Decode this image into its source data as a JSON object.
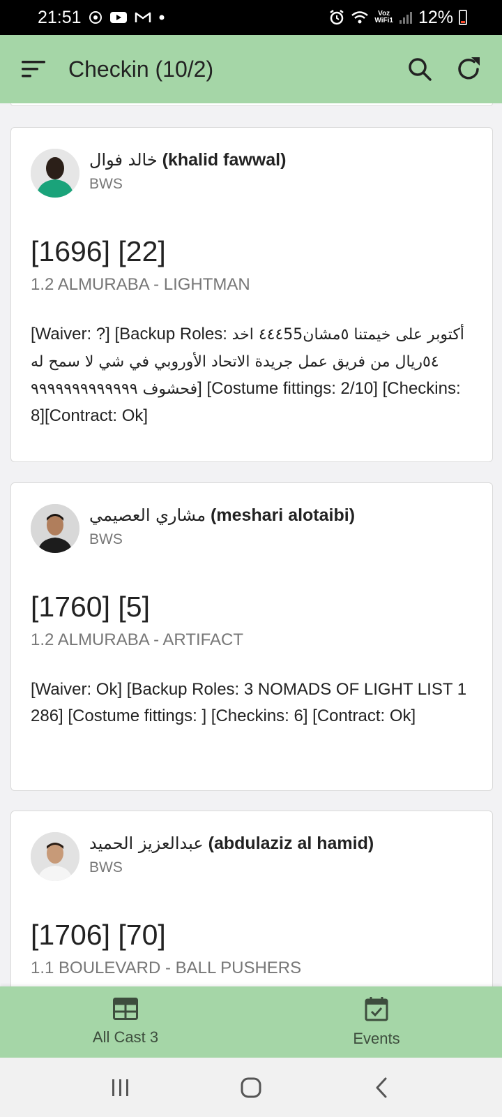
{
  "status_bar": {
    "time": "21:51",
    "voz_top": "Voz",
    "voz_bottom": "WiFi1",
    "battery": "12%",
    "icons": [
      "whatsapp-icon",
      "youtube-icon",
      "gmail-icon",
      "dot-icon",
      "alarm-icon",
      "wifi-icon",
      "signal-icon",
      "battery-icon"
    ]
  },
  "app_bar": {
    "title": "Checkin (10/2)",
    "icons": [
      "menu-sort-icon",
      "search-icon",
      "refresh-icon"
    ]
  },
  "cards": [
    {
      "name_ar": "خالد فوال",
      "name_en": "(khalid fawwal)",
      "group": "BWS",
      "ids": "[1696] [22]",
      "role": "1.2 ALMURABA - LIGHTMAN",
      "details_pre": "[Waiver: ?] [Backup Roles: ",
      "details_ar": "أكتوبر على خيمتنا ٥مشان٤٤٤55 اخد ٥٤ريال من فريق عمل جريدة الاتحاد الأوروبي في شي لا سمح له فحشوف ٩٩٩٩٩٩٩٩٩٩٩٩٩",
      "details_post": "] [Costume fittings: 2/10] [Checkins: 8][Contract: Ok]"
    },
    {
      "name_ar": "مشاري العصيمي",
      "name_en": "(meshari alotaibi)",
      "group": "BWS",
      "ids": "[1760] [5]",
      "role": "1.2 ALMURABA - ARTIFACT",
      "details": "[Waiver: Ok] [Backup Roles: 3 NOMADS OF LIGHT LIST 1 286] [Costume fittings: ] [Checkins: 6] [Contract: Ok]"
    },
    {
      "name_ar": "عبدالعزيز الحميد",
      "name_en": "(abdulaziz al hamid)",
      "group": "BWS",
      "ids": "[1706] [70]",
      "role": "1.1 BOULEVARD - BALL PUSHERS"
    }
  ],
  "bottom_nav": {
    "items": [
      {
        "label": "All Cast 3",
        "icon": "grid-table-icon"
      },
      {
        "label": "Events",
        "icon": "calendar-check-icon"
      }
    ]
  },
  "system_nav": [
    "recent-apps-icon",
    "home-icon",
    "back-icon"
  ],
  "colors": {
    "app_bar": "#a5d6a7",
    "bottom_nav": "#a5d6a7",
    "status_bar": "#000000",
    "background": "#f2f2f4"
  }
}
